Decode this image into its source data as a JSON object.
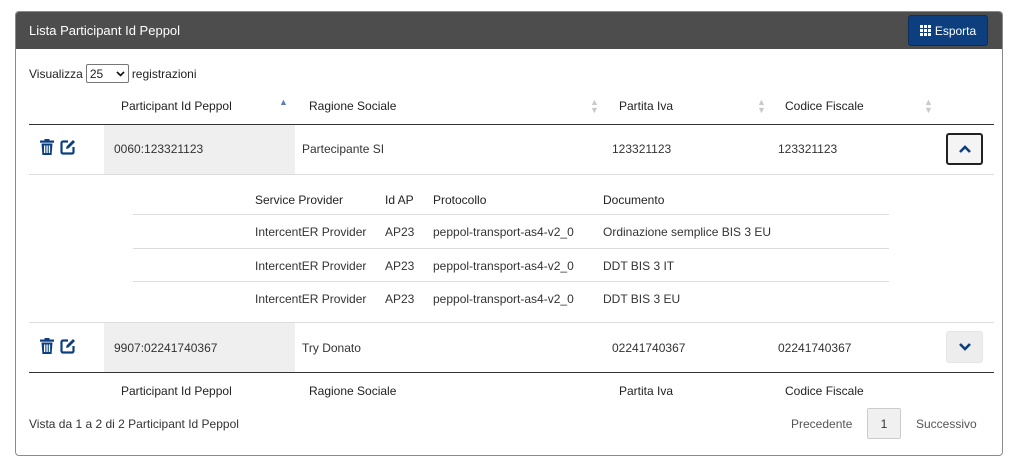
{
  "panel": {
    "title": "Lista Participant Id Peppol",
    "export_label": "Esporta"
  },
  "length_control": {
    "prefix": "Visualizza",
    "value": "25",
    "suffix": "registrazioni"
  },
  "columns": [
    "Participant Id Peppol",
    "Ragione Sociale",
    "Partita Iva",
    "Codice Fiscale"
  ],
  "rows": [
    {
      "participant_id": "0060:123321123",
      "ragione_sociale": "Partecipante SI",
      "partita_iva": "123321123",
      "codice_fiscale": "123321123",
      "expanded": true
    },
    {
      "participant_id": "9907:02241740367",
      "ragione_sociale": "Try Donato",
      "partita_iva": "02241740367",
      "codice_fiscale": "02241740367",
      "expanded": false
    }
  ],
  "detail": {
    "columns": [
      "Service Provider",
      "Id AP",
      "Protocollo",
      "Documento"
    ],
    "rows": [
      [
        "IntercentER Provider",
        "AP23",
        "peppol-transport-as4-v2_0",
        "Ordinazione semplice BIS 3 EU"
      ],
      [
        "IntercentER Provider",
        "AP23",
        "peppol-transport-as4-v2_0",
        "DDT BIS 3 IT"
      ],
      [
        "IntercentER Provider",
        "AP23",
        "peppol-transport-as4-v2_0",
        "DDT BIS 3 EU"
      ]
    ]
  },
  "footer": {
    "info": "Vista da 1 a 2 di 2 Participant Id Peppol",
    "prev": "Precedente",
    "page": "1",
    "next": "Successivo"
  },
  "icons": {
    "export": "grid-icon",
    "delete": "trash-icon",
    "edit": "edit-icon",
    "collapse": "chevron-up-icon",
    "expand": "chevron-down-icon"
  },
  "colors": {
    "header_bg": "#4d4d4d",
    "accent": "#0d3f7f",
    "sort_active": "#5b7fb3"
  }
}
